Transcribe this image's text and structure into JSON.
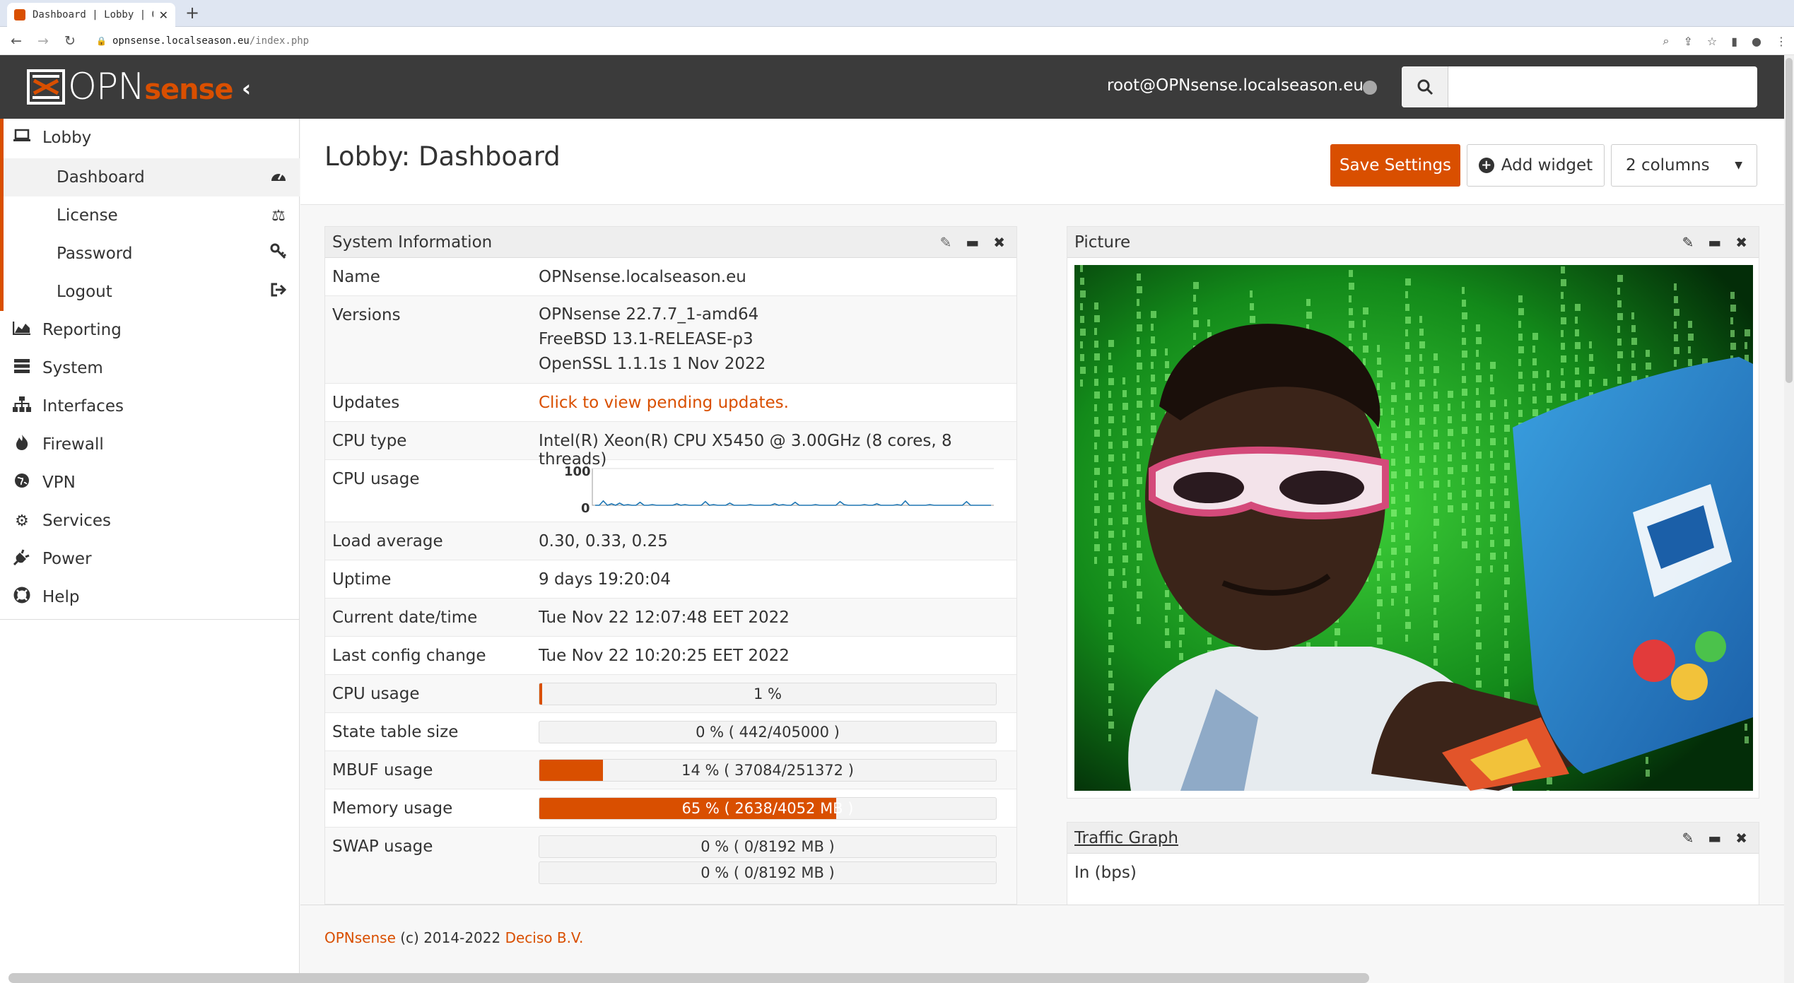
{
  "browser": {
    "tab_title": "Dashboard | Lobby | OPN",
    "url_host": "opnsense.localseason.eu",
    "url_path": "/index.php"
  },
  "header": {
    "logo_left": "OPN",
    "logo_right": "sense",
    "user": "root@OPNsense.localseason.eu",
    "search_placeholder": ""
  },
  "sidebar": {
    "lobby": "Lobby",
    "sub": [
      {
        "label": "Dashboard",
        "icon": "dashboard-icon"
      },
      {
        "label": "License",
        "icon": "balance-scale-icon"
      },
      {
        "label": "Password",
        "icon": "key-icon"
      },
      {
        "label": "Logout",
        "icon": "sign-out-icon"
      }
    ],
    "items": [
      {
        "label": "Reporting",
        "icon": "area-chart-icon"
      },
      {
        "label": "System",
        "icon": "server-icon"
      },
      {
        "label": "Interfaces",
        "icon": "sitemap-icon"
      },
      {
        "label": "Firewall",
        "icon": "fire-icon"
      },
      {
        "label": "VPN",
        "icon": "globe-icon"
      },
      {
        "label": "Services",
        "icon": "cog-icon"
      },
      {
        "label": "Power",
        "icon": "plug-icon"
      },
      {
        "label": "Help",
        "icon": "life-ring-icon"
      }
    ]
  },
  "main": {
    "title": "Lobby: Dashboard",
    "save": "Save Settings",
    "add_widget": "Add widget",
    "columns": "2 columns"
  },
  "sysinfo": {
    "title": "System Information",
    "name_k": "Name",
    "name_v": "OPNsense.localseason.eu",
    "versions_k": "Versions",
    "versions_v": [
      "OPNsense 22.7.7_1-amd64",
      "FreeBSD 13.1-RELEASE-p3",
      "OpenSSL 1.1.1s 1 Nov 2022"
    ],
    "updates_k": "Updates",
    "updates_v": "Click to view pending updates.",
    "cputype_k": "CPU type",
    "cputype_v": "Intel(R) Xeon(R) CPU X5450 @ 3.00GHz (8 cores, 8 threads)",
    "cpuusage_k": "CPU usage",
    "spark": {
      "ymax": "100",
      "ymin": "0",
      "values": [
        0,
        0,
        12,
        0,
        4,
        0,
        6,
        0,
        2,
        0,
        0,
        8,
        0,
        0,
        2,
        0,
        0,
        0,
        0,
        0,
        4,
        0,
        2,
        0,
        0,
        0,
        0,
        10,
        0,
        2,
        0,
        0,
        0,
        6,
        0,
        0,
        0,
        0,
        2,
        0,
        0,
        0,
        0,
        0,
        4,
        0,
        2,
        0,
        0,
        8,
        0,
        0,
        0,
        0,
        2,
        0,
        0,
        0,
        0,
        0,
        10,
        2,
        0,
        0,
        0,
        0,
        2,
        0,
        0,
        4,
        0,
        0,
        0,
        0,
        2,
        0,
        12,
        0,
        0,
        0,
        0,
        0,
        2,
        0,
        0,
        0,
        0,
        0,
        0,
        0,
        0,
        10,
        0,
        0,
        0,
        0,
        0,
        0
      ]
    },
    "load_k": "Load average",
    "load_v": "0.30, 0.33, 0.25",
    "uptime_k": "Uptime",
    "uptime_v": "9 days 19:20:04",
    "date_k": "Current date/time",
    "date_v": "Tue Nov 22 12:07:48 EET 2022",
    "config_k": "Last config change",
    "config_v": "Tue Nov 22 10:20:25 EET 2022",
    "cpu2_k": "CPU usage",
    "cpu2_txt": "1 %",
    "cpu2_pct": 1,
    "state_k": "State table size",
    "state_txt": "0 % ( 442/405000 )",
    "state_pct": 0,
    "mbuf_k": "MBUF usage",
    "mbuf_txt": "14 % ( 37084/251372 )",
    "mbuf_pct": 14,
    "mem_k": "Memory usage",
    "mem_txt": "65 % ( 2638/4052 MB )",
    "mem_pct": 65,
    "swap_k": "SWAP usage",
    "swap_txt1": "0 % ( 0/8192 MB )",
    "swap_txt2": "0 % ( 0/8192 MB )"
  },
  "picture": {
    "title": "Picture"
  },
  "traffic": {
    "title": "Traffic Graph",
    "in": "In (bps)"
  },
  "footer": {
    "brand": "OPNsense",
    "mid": " (c) 2014-2022 ",
    "company": "Deciso B.V."
  },
  "colors": {
    "accent": "#d94f00",
    "header": "#3b3b3b"
  }
}
